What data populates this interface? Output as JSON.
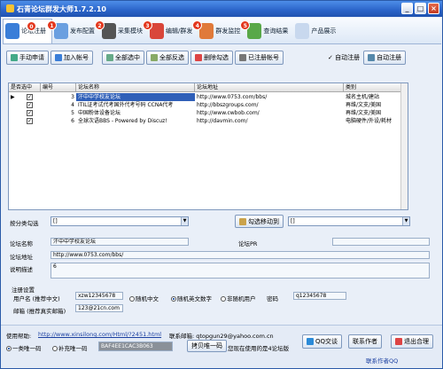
{
  "window": {
    "title": "石青论坛群发大师1.7.2.10"
  },
  "tabs": [
    {
      "label": "论坛注册",
      "badge": "",
      "color": "#3a7ed8"
    },
    {
      "label": "发布配置",
      "badge": "1",
      "color": "#6a9fe0"
    },
    {
      "label": "采集模块",
      "badge": "2",
      "color": "#444"
    },
    {
      "label": "编辑/群发",
      "badge": "3",
      "color": "#d9463a"
    },
    {
      "label": "群发监控",
      "badge": "4",
      "color": "#e07a3a"
    },
    {
      "label": "查询结果",
      "badge": "5",
      "color": "#58a848"
    },
    {
      "label": "产品展示",
      "badge": "",
      "color": "#7aa0d0"
    }
  ],
  "toolbar": {
    "manual_apply": "手动申请",
    "add_account": "加入帐号",
    "select_all": "全部选中",
    "invert_select": "全部反选",
    "delete_checked": "删除勾选",
    "registered_account": "已注册帐号",
    "auto_register": "自动注册",
    "auto_register_btn": "自动注册"
  },
  "grid": {
    "headers": [
      "是否选中",
      "编号",
      "论坛名称",
      "论坛地址",
      "类别"
    ],
    "rows": [
      {
        "checked": true,
        "id": "3",
        "name": "汗中中学校友论坛",
        "url": "http://www.0753.com/bbs/",
        "cat": "城名主机/建站",
        "selected": true
      },
      {
        "checked": true,
        "id": "4",
        "name": "ITIL证考试代考国外代考号码 CCNA代考",
        "url": "http://bbszgroups.com/",
        "cat": "再维/文支/美国"
      },
      {
        "checked": true,
        "id": "5",
        "name": "中国粉体设备论坛",
        "url": "http://www.cwbob.com/",
        "cat": "再维/文支/美国"
      },
      {
        "checked": true,
        "id": "6",
        "name": "全球次语BBS  - Powered by Discuz!",
        "url": "http://davmin.com/",
        "cat": "电脑硬件/外设/耗材"
      }
    ]
  },
  "group": {
    "label": "按分类勾选",
    "value": "[]",
    "move_btn": "勾选移动到",
    "move_value": "[]"
  },
  "detail": {
    "name_label": "论坛名称",
    "name_value": "汗中中学校友论坛",
    "pr_label": "论坛PR",
    "pr_value": "",
    "url_label": "论坛地址",
    "url_value": "http://www.0753.com/bbs/",
    "desc_label": "说明描述",
    "desc_value": "6"
  },
  "reg": {
    "title": "注册设置",
    "user_label": "用户名 (推荐中文)",
    "user_value": "xzw12345678",
    "opt1": "随机中文",
    "opt2": "随机英文数字",
    "opt3": "非随机用户",
    "pwd_label": "密码",
    "pwd_value": "q12345678",
    "email_label": "邮箱 (推荐真实邮箱)",
    "email_value": "123@21cn.com"
  },
  "footer": {
    "use_help": "使用帮助:",
    "help_url": "http://www.xinsilong.com/Html/?2451.html",
    "contact": "联系邮箱: qtopgun29@yahoo.com.cn",
    "radio1": "一类唯一码",
    "radio2": "补充唯一码",
    "code": "BAF4EE1CAC3B063",
    "copy_btn": "拷贝唯一码",
    "status": "您现在使用的是4论坛版",
    "qq_btn": "QQ交谈",
    "contact_author": "联系作者",
    "exit": "退出合理",
    "contact_qq": "联系作者QQ"
  }
}
